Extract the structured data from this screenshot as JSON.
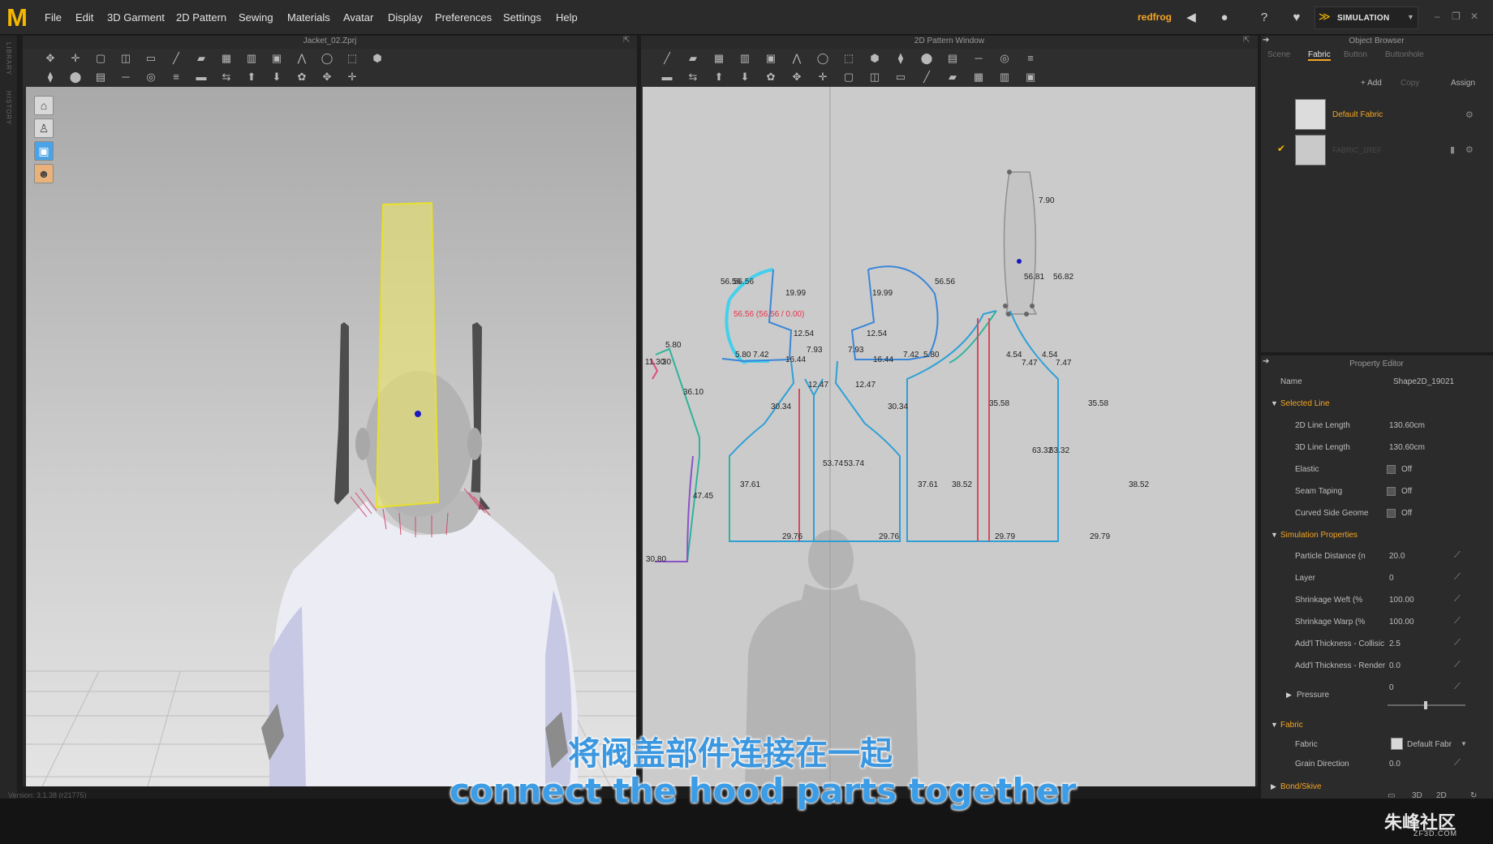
{
  "app": {
    "logo": "M",
    "menu": [
      "File",
      "Edit",
      "3D Garment",
      "2D Pattern",
      "Sewing",
      "Materials",
      "Avatar",
      "Display",
      "Preferences",
      "Settings",
      "Help"
    ],
    "user": "redfrog",
    "simulation_label": "SIMULATION",
    "left_strip": [
      "LIBRARY",
      "HISTORY"
    ],
    "accent_color": "#f5b700"
  },
  "window3d": {
    "title": "Jacket_02.Zprj",
    "version": "Version: 3.1.38 (r21775)"
  },
  "window2d": {
    "title": "2D Pattern Window",
    "measurements": {
      "hood_left_top": "56.56",
      "hood_left_top2": "56.56",
      "hood_left_mid": "19.99",
      "hood_left_sel": "56.56 (56.56 / 0.00)",
      "hood_left_low": "12.54",
      "hood_left_side": "7.93",
      "hood_left_neck": "16.44",
      "hood_left_a": "5.80",
      "hood_left_b": "7.42",
      "hood_right_top": "56.56",
      "hood_right_mid": "19.99",
      "hood_right_low": "12.54",
      "hood_right_side": "7.93",
      "hood_right_neck": "16.44",
      "hood_right_a": "7.42",
      "hood_right_b": "5.80",
      "sleeve_top": "5.80",
      "sleeve_left": "11.30",
      "sleeve_left2": "30",
      "sleeve_side": "36.10",
      "sleeve_low": "47.45",
      "sleeve_bottom": "30.80",
      "front_l_shoulder": "12.47",
      "front_l_arm": "30.34",
      "front_l_center": "53.74",
      "front_l_side": "37.61",
      "front_l_hem": "29.76",
      "front_r_shoulder": "12.47",
      "front_r_arm": "30.34",
      "front_r_center": "53.74",
      "front_r_side": "37.61",
      "front_r_hem": "29.76",
      "tab_top": "7.90",
      "tab_left": "56.81",
      "tab_right": "56.82",
      "tab_bottom_a": "4.54",
      "tab_bottom_b": "4.54",
      "back_l_a": "7.47",
      "back_r_a": "7.47",
      "back_l_arm": "35.58",
      "back_r_arm": "35.58",
      "back_center_a": "63.32",
      "back_center_b": "63.32",
      "back_l_side": "38.52",
      "back_r_side": "38.52",
      "back_l_hem": "29.79",
      "back_r_hem": "29.79"
    }
  },
  "object_browser": {
    "title": "Object Browser",
    "tabs": [
      "Scene",
      "Fabric",
      "Button",
      "Buttonhole"
    ],
    "active_tab": "Fabric",
    "actions": {
      "add": "+ Add",
      "copy": "Copy",
      "assign": "Assign"
    },
    "fabrics": [
      {
        "name": "Default Fabric",
        "active": true
      },
      {
        "name": "FABRIC_1REF",
        "active": false
      }
    ]
  },
  "property_editor": {
    "title": "Property Editor",
    "name_label": "Name",
    "name_value": "Shape2D_19021",
    "selected_line": {
      "header": "Selected Line",
      "rows": [
        {
          "label": "2D Line Length",
          "value": "130.60cm"
        },
        {
          "label": "3D Line Length",
          "value": "130.60cm"
        },
        {
          "label": "Elastic",
          "value": "Off"
        },
        {
          "label": "Seam Taping",
          "value": "Off"
        },
        {
          "label": "Curved Side Geome",
          "value": "Off"
        }
      ]
    },
    "simulation": {
      "header": "Simulation Properties",
      "rows": [
        {
          "label": "Particle Distance (n",
          "value": "20.0"
        },
        {
          "label": "Layer",
          "value": "0"
        },
        {
          "label": "Shrinkage Weft (%",
          "value": "100.00"
        },
        {
          "label": "Shrinkage Warp (%",
          "value": "100.00"
        },
        {
          "label": "Add'l Thickness - Collisic",
          "value": "2.5"
        },
        {
          "label": "Add'l Thickness - Render",
          "value": "0.0"
        }
      ],
      "pressure_label": "Pressure",
      "pressure_value": "0"
    },
    "fabric": {
      "header": "Fabric",
      "fabric_label": "Fabric",
      "fabric_value": "Default Fabr",
      "grain_label": "Grain Direction",
      "grain_value": "0.0",
      "next_header": "Bond/Skive"
    }
  },
  "subtitles": {
    "chinese": "将阀盖部件连接在一起",
    "english": "connect the hood parts together"
  },
  "watermark": {
    "logo": "朱峰社区",
    "url": "ZF3D.COM"
  }
}
